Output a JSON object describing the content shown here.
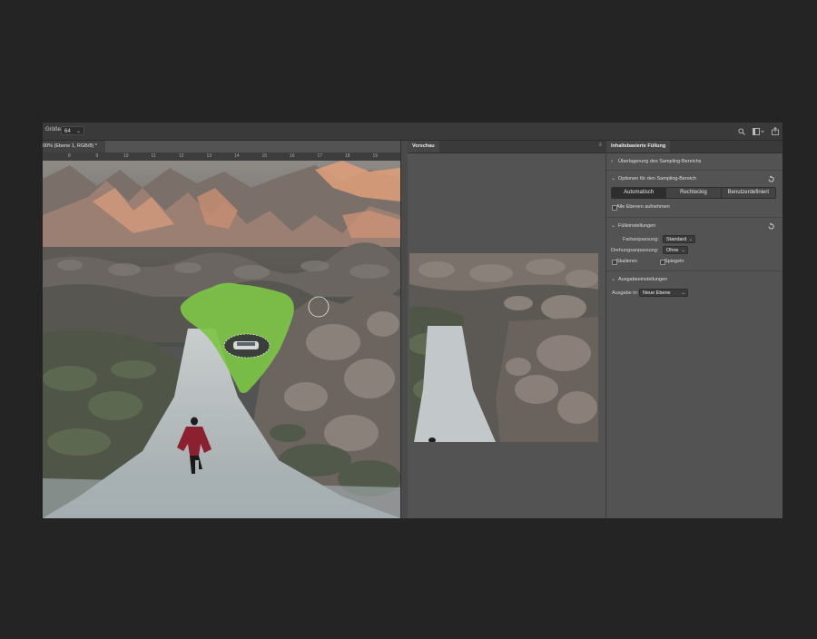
{
  "options_bar": {
    "size_label": "Größe:",
    "size_value": "64"
  },
  "document": {
    "tab_title": "00% (Ebene 1, RGB/8) *",
    "ruler_ticks": [
      "8",
      "9",
      "10",
      "11",
      "12",
      "13",
      "14",
      "15",
      "16",
      "17",
      "18",
      "19",
      "20"
    ]
  },
  "preview_panel": {
    "tab_label": "Vorschau"
  },
  "properties_panel": {
    "tab_label": "Inhaltsbasierte Füllung",
    "overlay_section": "Überlagerung des Sampling-Bereichs",
    "sampling_section": "Optionen für den Sampling-Bereich",
    "sampling_buttons": [
      "Automatisch",
      "Rechteckig",
      "Benutzerdefiniert"
    ],
    "sampling_selected": "Automatisch",
    "all_layers_label": "Alle Ebenen aufnehmen",
    "fill_section": "Fülleinstellungen",
    "color_adapt_label": "Farbanpassung:",
    "color_adapt_value": "Standard",
    "rotation_adapt_label": "Drehungsanpassung:",
    "rotation_adapt_value": "Ohne",
    "scale_label": "Skalieren",
    "mirror_label": "Spiegeln",
    "output_section": "Ausgabeeinstellungen",
    "output_label": "Ausgabe in:",
    "output_value": "Neue Ebene"
  },
  "colors": {
    "selection_overlay": "#7dc447",
    "app_bg": "#535353"
  }
}
